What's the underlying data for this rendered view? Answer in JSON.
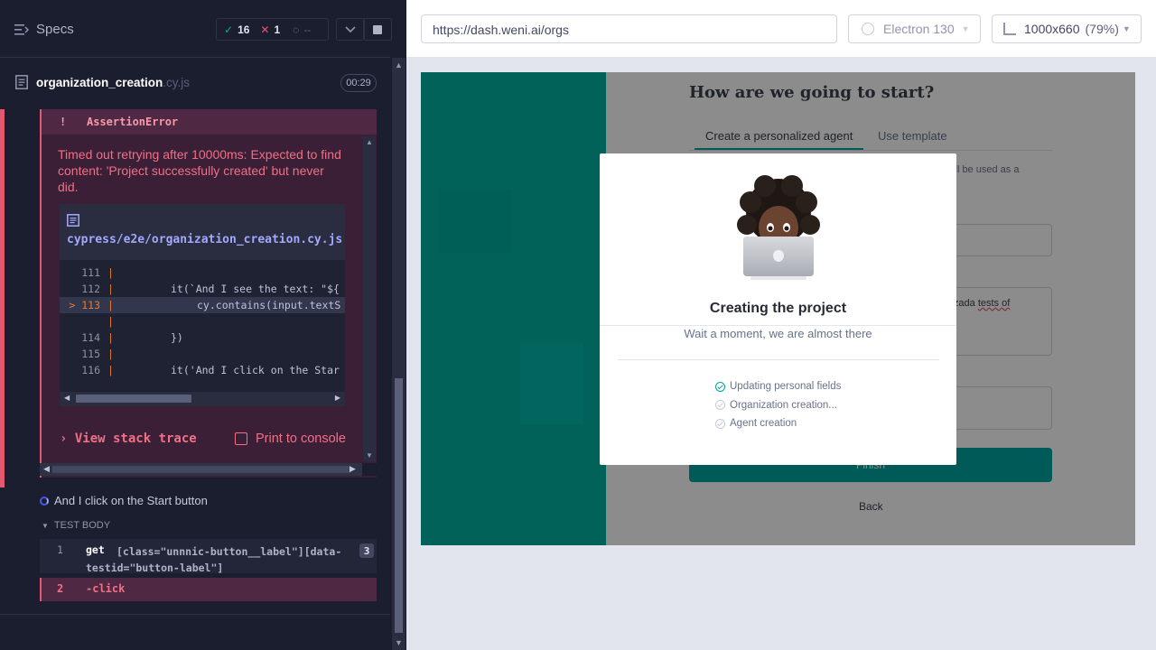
{
  "reporter": {
    "specs_label": "Specs",
    "stats": {
      "passed": "16",
      "failed": "1",
      "pending": "--"
    },
    "spec": {
      "name": "organization_creation",
      "ext": ".cy.js",
      "duration": "00:29"
    },
    "error": {
      "marker": "!",
      "name": "AssertionError",
      "message": "Timed out retrying after 10000ms: Expected to find content: 'Project successfully created' but never did.",
      "file_path": "cypress/e2e/organization_creation.cy.js:113:68",
      "code_lines": [
        {
          "num": "111",
          "code": ""
        },
        {
          "num": "112",
          "code": "it(`And I see the text: \"${"
        },
        {
          "num": "113",
          "code": "cy.contains(input.textS"
        },
        {
          "num": "114",
          "code": "})"
        },
        {
          "num": "115",
          "code": ""
        },
        {
          "num": "116",
          "code": "it('And I click on the Star"
        }
      ],
      "view_stack": "View stack trace",
      "print_console": "Print to console"
    },
    "current_step": "And I click on the Start button",
    "test_body_label": "TEST BODY",
    "commands": [
      {
        "num": "1",
        "method": "get",
        "selector": "[class=\"unnnic-button__label\"][data-testid=\"button-label\"]",
        "count": "3"
      },
      {
        "num": "2",
        "method": "-click"
      }
    ]
  },
  "aut": {
    "url": "https://dash.weni.ai/orgs",
    "browser": "Electron 130",
    "viewport": "1000x660",
    "zoom": "(79%)",
    "page": {
      "title": "How are we going to start?",
      "tabs": [
        "Create a personalized agent",
        "Use template"
      ],
      "desc_fragment": "t will be used as a",
      "field_text_prefix": "omatizada ",
      "field_text_typo": "tests of",
      "finish": "Finish",
      "back": "Back"
    },
    "modal": {
      "title": "Creating the project",
      "subtitle": "Wait a moment, we are almost there",
      "steps": [
        "Updating personal fields",
        "Organization creation...",
        "Agent creation"
      ]
    }
  }
}
